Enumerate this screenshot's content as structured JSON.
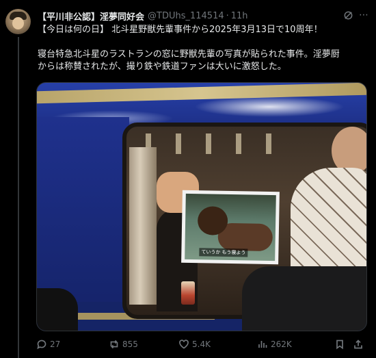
{
  "post": {
    "author_name": "【平川非公認】淫夢同好会",
    "author_handle": "@TDUhs_114514",
    "separator": "·",
    "time": "11h",
    "line1": "【今日は何の日】 北斗星野獣先輩事件から2025年3月13日で10周年！",
    "line2": "寝台特急北斗星のラストランの窓に野獣先輩の写真が貼られた事件。淫夢厨",
    "line3": "からは称賛されたが、撮り鉄や鉄道ファンは大いに激怒した。",
    "image_caption": "ていうか もう寝よう"
  },
  "actions": {
    "replies": "27",
    "reposts": "855",
    "likes": "5.4K",
    "views": "262K"
  },
  "icons": {
    "grok": "grok-icon",
    "more": "more-icon",
    "reply": "reply-icon",
    "repost": "repost-icon",
    "like": "heart-icon",
    "views": "views-icon",
    "bookmark": "bookmark-icon",
    "share": "share-icon"
  },
  "colors": {
    "background": "#000000",
    "text": "#e7e9ea",
    "secondary": "#71767b"
  }
}
